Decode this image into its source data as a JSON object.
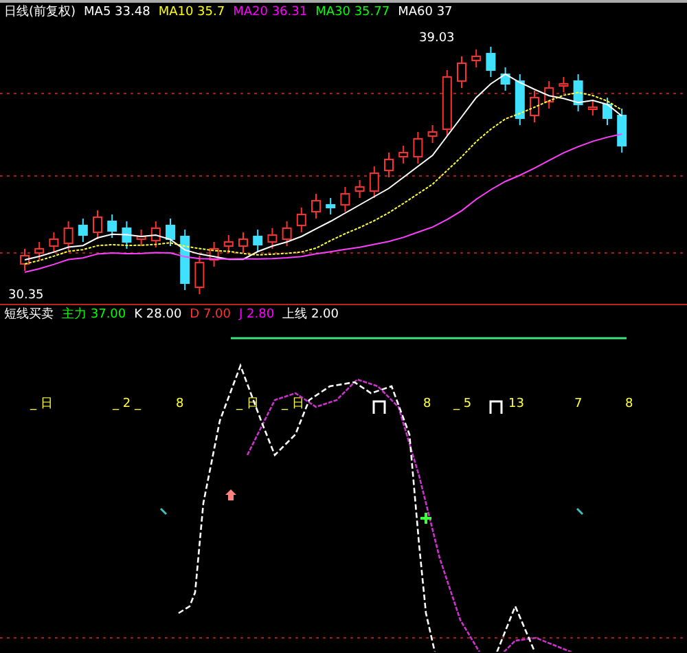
{
  "price_panel": {
    "legend": [
      {
        "text": "日线(前复权)",
        "color": "#ffffff"
      },
      {
        "text": "MA5 33.48",
        "color": "#ffffff"
      },
      {
        "text": "MA10 35.7",
        "color": "#ffff00"
      },
      {
        "text": "MA20 36.31",
        "color": "#ff00ff"
      },
      {
        "text": "MA30 35.77",
        "color": "#00ff00"
      },
      {
        "text": "MA60 37",
        "color": "#ffffff"
      }
    ],
    "high_label": "39.03",
    "low_label": "30.35"
  },
  "indicator_panel": {
    "legend": [
      {
        "text": "短线买卖",
        "color": "#ffffff"
      },
      {
        "text": "主力 37.00",
        "color": "#00ff00"
      },
      {
        "text": "K 28.00",
        "color": "#ffffff"
      },
      {
        "text": "D 7.00",
        "color": "#ff3333"
      },
      {
        "text": "J 2.80",
        "color": "#ff00ff"
      },
      {
        "text": "上线 2.00",
        "color": "#ffffff"
      }
    ],
    "markers": [
      {
        "text": "_ 日",
        "kind": "count"
      },
      {
        "text": "_ 2 _",
        "kind": "count"
      },
      {
        "text": "8",
        "kind": "count"
      },
      {
        "text": "_ 日",
        "kind": "count"
      },
      {
        "text": "_ 日",
        "kind": "count"
      },
      {
        "text": "8",
        "kind": "count"
      },
      {
        "text": "_ 5",
        "kind": "count"
      },
      {
        "text": "13",
        "kind": "count"
      },
      {
        "text": "7",
        "kind": "count"
      },
      {
        "text": "8",
        "kind": "count"
      }
    ]
  }
}
